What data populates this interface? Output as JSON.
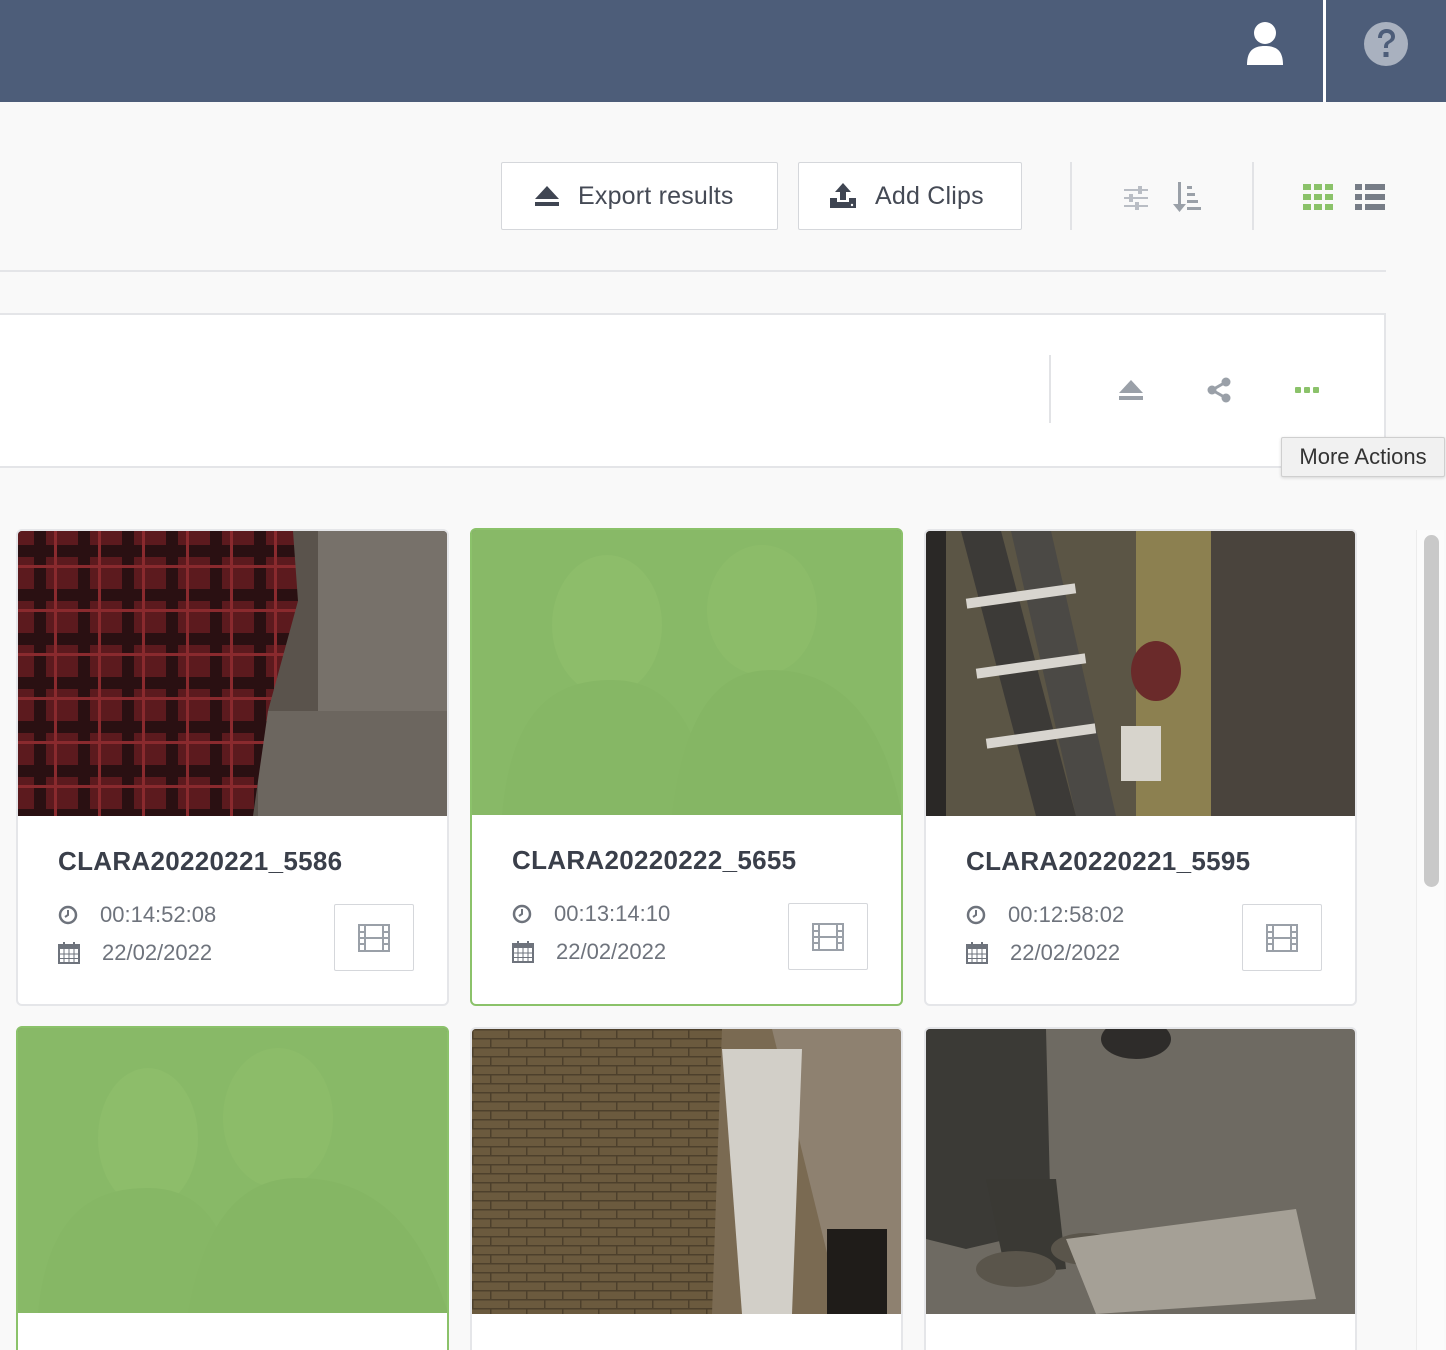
{
  "topbar": {
    "background": "#4d5d79",
    "user_icon": "user-icon",
    "help_icon": "help-icon"
  },
  "toolbar": {
    "export_label": "Export results",
    "export_icon": "eject-icon",
    "add_clips_label": "Add Clips",
    "add_clips_icon": "upload-icon",
    "filter_icon": "sliders-icon",
    "sort_icon": "sort-icon",
    "grid_view_icon": "grid-icon",
    "list_view_icon": "list-icon",
    "active_view": "grid",
    "accent_color": "#8bc26a"
  },
  "panel": {
    "eject_icon": "eject-icon",
    "share_icon": "share-icon",
    "more_icon": "more-dots-icon",
    "tooltip": "More Actions"
  },
  "clips": [
    {
      "title": "CLARA20220221_5586",
      "duration": "00:14:52:08",
      "date": "22/02/2022",
      "selected": false
    },
    {
      "title": "CLARA20220222_5655",
      "duration": "00:13:14:10",
      "date": "22/02/2022",
      "selected": true
    },
    {
      "title": "CLARA20220221_5595",
      "duration": "00:12:58:02",
      "date": "22/02/2022",
      "selected": false
    },
    {
      "title": "",
      "duration": "",
      "date": "",
      "selected": true
    },
    {
      "title": "",
      "duration": "",
      "date": "",
      "selected": false
    },
    {
      "title": "",
      "duration": "",
      "date": "",
      "selected": false
    }
  ]
}
